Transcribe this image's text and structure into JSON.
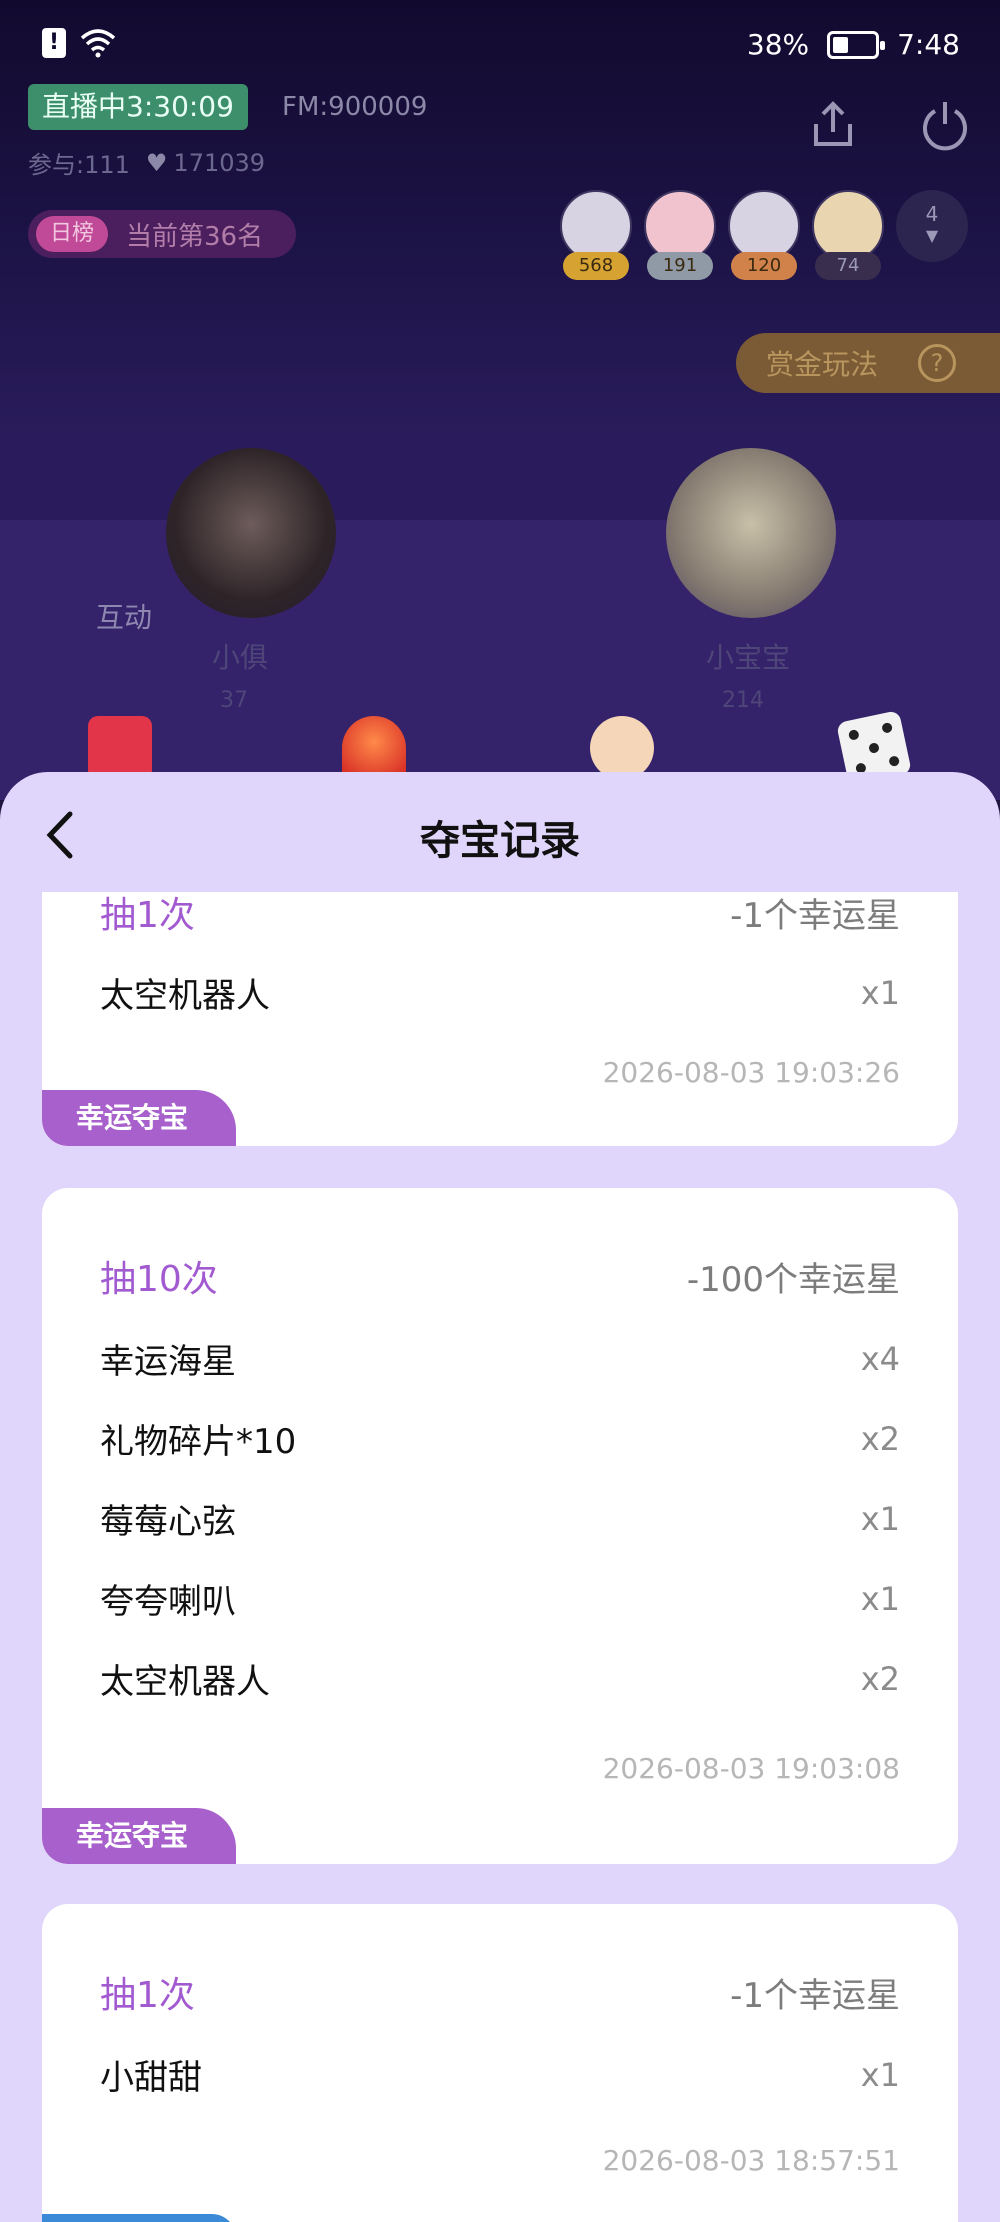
{
  "status_bar": {
    "battery": "38%",
    "battery_level": 0.38,
    "time": "7:48"
  },
  "room": {
    "live_badge": "直播中3:30:09",
    "fm": "FM:900009",
    "participants": "参与:111",
    "likes": "171039",
    "rank_tag": "日榜",
    "rank_text": "当前第36名",
    "audience": [
      {
        "score": "568",
        "color": "#d6a332"
      },
      {
        "score": "191",
        "color": "#8f9aa6"
      },
      {
        "score": "120",
        "color": "#d0824a"
      },
      {
        "score": "74",
        "color": "#3a2e4e"
      }
    ],
    "audience_more": "4",
    "bounty_label": "赏金玩法",
    "hosts": [
      {
        "name": "小俱",
        "count": "37"
      },
      {
        "name": "小宝宝",
        "count": "214"
      }
    ],
    "interact_label": "互动"
  },
  "sheet": {
    "title": "夺宝记录",
    "records": [
      {
        "draw": "抽1次",
        "cost": "-1个幸运星",
        "items": [
          {
            "name": "太空机器人",
            "qty": "x1"
          }
        ],
        "time": "2026-08-03 19:03:26",
        "tag": "幸运夺宝"
      },
      {
        "draw": "抽10次",
        "cost": "-100个幸运星",
        "items": [
          {
            "name": "幸运海星",
            "qty": "x4"
          },
          {
            "name": "礼物碎片*10",
            "qty": "x2"
          },
          {
            "name": "莓莓心弦",
            "qty": "x1"
          },
          {
            "name": "夸夸喇叭",
            "qty": "x1"
          },
          {
            "name": "太空机器人",
            "qty": "x2"
          }
        ],
        "time": "2026-08-03 19:03:08",
        "tag": "幸运夺宝"
      },
      {
        "draw": "抽1次",
        "cost": "-1个幸运星",
        "items": [
          {
            "name": "小甜甜",
            "qty": "x1"
          }
        ],
        "time": "2026-08-03 18:57:51",
        "tag": ""
      }
    ]
  }
}
